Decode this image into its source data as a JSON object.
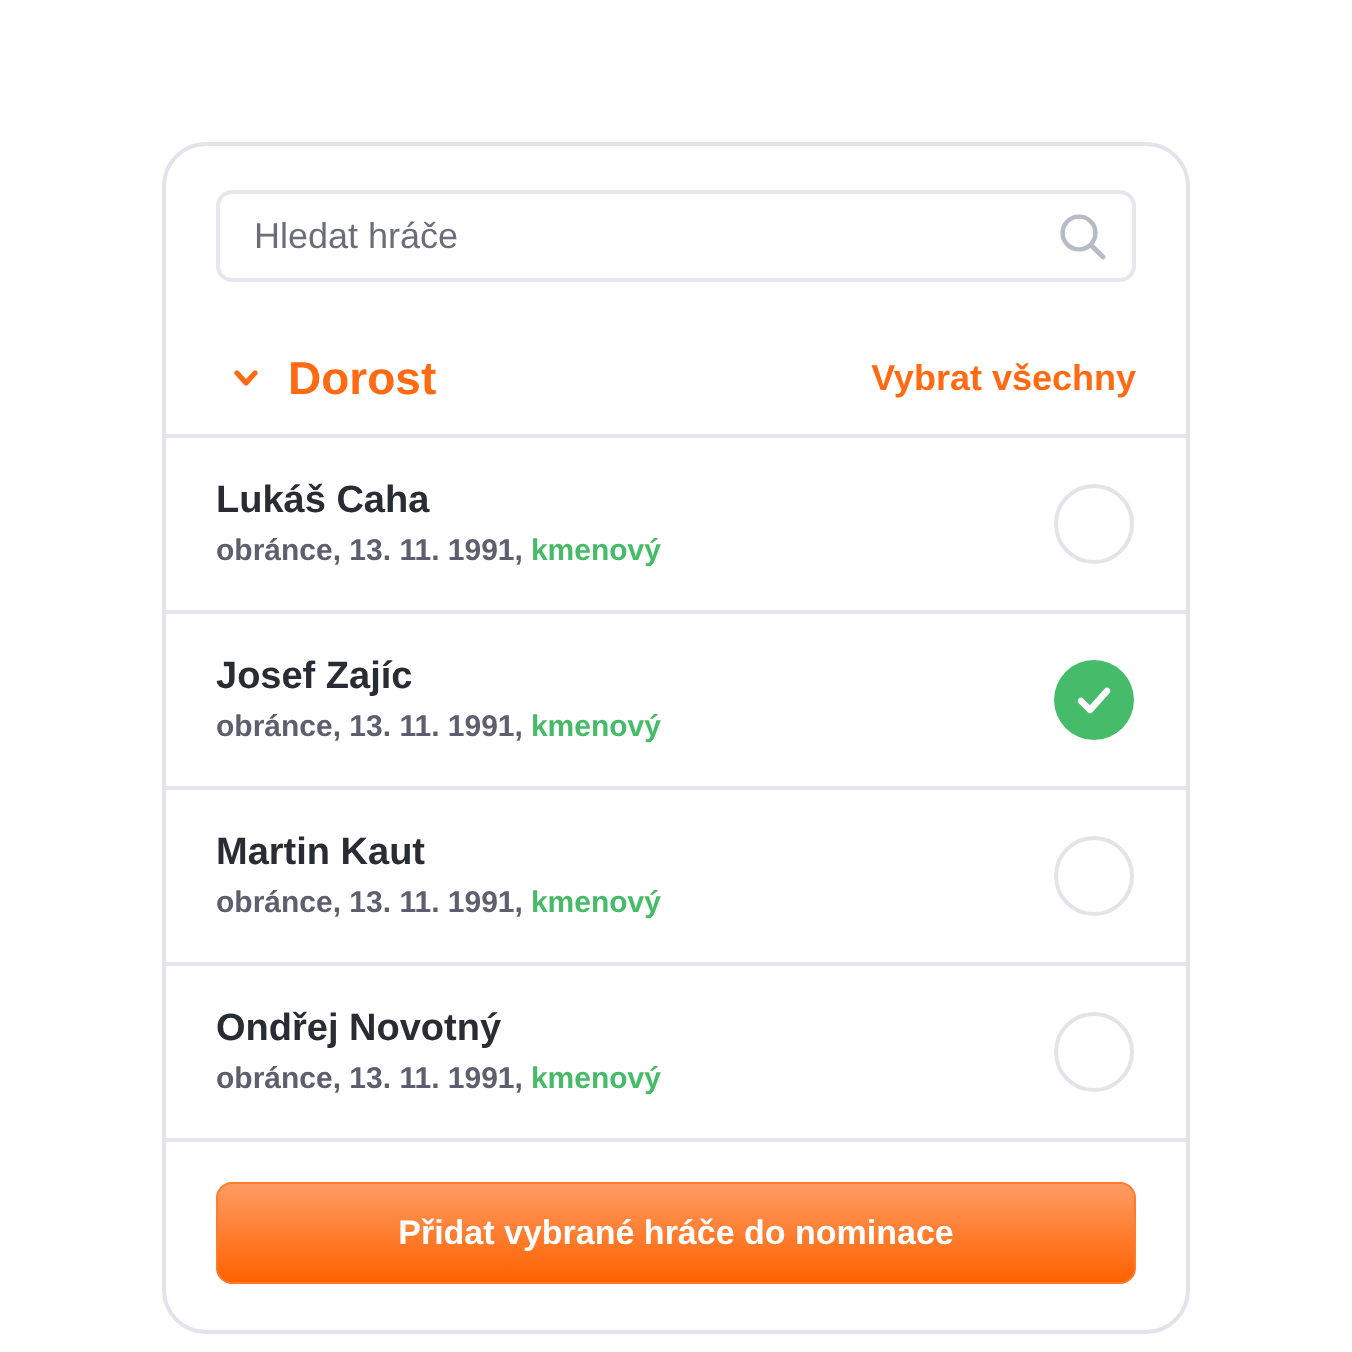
{
  "search": {
    "placeholder": "Hledat hráče"
  },
  "group": {
    "title": "Dorost",
    "expanded": true,
    "select_all": "Vybrat všechny"
  },
  "players": [
    {
      "name": "Lukáš Caha",
      "details": "obránce, 13. 11. 1991,",
      "status": "kmenový",
      "selected": false
    },
    {
      "name": "Josef Zajíc",
      "details": "obránce, 13. 11. 1991,",
      "status": "kmenový",
      "selected": true
    },
    {
      "name": "Martin Kaut",
      "details": "obránce, 13. 11. 1991,",
      "status": "kmenový",
      "selected": false
    },
    {
      "name": "Ondřej Novotný",
      "details": "obránce, 13. 11. 1991,",
      "status": "kmenový",
      "selected": false
    }
  ],
  "button": {
    "label": "Přidat vybrané hráče do nominace"
  }
}
